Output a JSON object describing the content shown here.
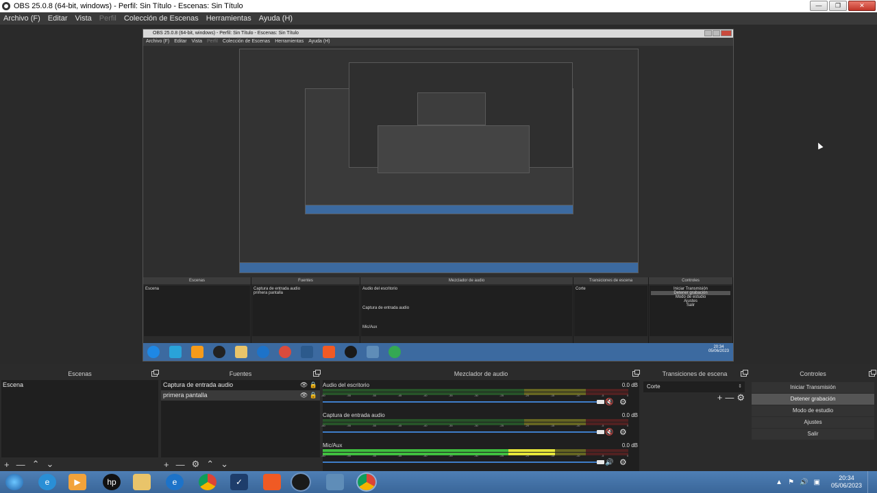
{
  "window": {
    "title": "OBS 25.0.8 (64-bit, windows) - Perfil: Sin Título - Escenas: Sin Título",
    "min": "—",
    "max": "❐",
    "close": "✕"
  },
  "menu": {
    "archivo": "Archivo (F)",
    "editar": "Editar",
    "vista": "Vista",
    "perfil": "Perfil",
    "coleccion": "Colección de Escenas",
    "herramientas": "Herramientas",
    "ayuda": "Ayuda (H)"
  },
  "nested": {
    "title": "OBS 25.0.8 (64-bit, windows) - Perfil: Sin Título - Escenas: Sin Título",
    "menu": [
      "Archivo (F)",
      "Editar",
      "Vista",
      "Perfil",
      "Colección de Escenas",
      "Herramientas",
      "Ayuda (H)"
    ],
    "panels": [
      "Escenas",
      "Fuentes",
      "Mezclador de audio",
      "Transiciones de escena",
      "Controles"
    ],
    "scene": "Escena",
    "sources": [
      "Captura de entrada audio",
      "primera pantalla"
    ],
    "tracks": [
      "Audio del escritorio",
      "Captura de entrada audio",
      "Mic/Aux"
    ],
    "db": "0.0 dB",
    "transition": "Corte",
    "controls": [
      "Iniciar Transmisión",
      "Detener grabación",
      "Modo de estudio",
      "Ajustes",
      "Salir"
    ],
    "time": "20:34",
    "date": "05/06/2023"
  },
  "scenes": {
    "header": "Escenas",
    "items": [
      "Escena"
    ]
  },
  "sources": {
    "header": "Fuentes",
    "items": [
      "Captura de entrada audio",
      "primera pantalla"
    ]
  },
  "mixer": {
    "header": "Mezclador de audio",
    "tracks": [
      {
        "name": "Audio del escritorio",
        "db": "0.0 dB",
        "level": 0.0,
        "fader": 1.0
      },
      {
        "name": "Captura de entrada audio",
        "db": "0.0 dB",
        "level": 0.0,
        "fader": 1.0
      },
      {
        "name": "Mic/Aux",
        "db": "0.0 dB",
        "level": 0.76,
        "fader": 1.0
      }
    ],
    "scale": [
      "-60",
      "-55",
      "-50",
      "-45",
      "-40",
      "-35",
      "-30",
      "-25",
      "-20",
      "-15",
      "-10",
      "-5",
      "0"
    ]
  },
  "transitions": {
    "header": "Transiciones de escena",
    "selected": "Corte"
  },
  "controls": {
    "header": "Controles",
    "start_stream": "Iniciar Transmisión",
    "stop_record": "Detener grabación",
    "studio_mode": "Modo de estudio",
    "settings": "Ajustes",
    "exit": "Salir"
  },
  "footer_glyphs": {
    "add": "+",
    "remove": "—",
    "up": "⌃",
    "down": "⌄",
    "gear": "⚙",
    "eye": "👁",
    "lock": "🔒",
    "speaker": "🔊",
    "muted": "🔇",
    "cursor": "▲"
  },
  "taskbar": {
    "time": "20:34",
    "date": "05/06/2023",
    "tray_up": "▲",
    "tray_flag": "⚑",
    "tray_volume": "🔊",
    "tray_network": "▣",
    "icons": [
      "start-orb-icon",
      "internet-explorer-icon",
      "media-player-icon",
      "hp-icon",
      "file-explorer-icon",
      "edge-icon",
      "chrome-icon",
      "email-icon",
      "brave-icon",
      "obs-icon",
      "photos-icon",
      "chrome-active-icon"
    ]
  },
  "colors": {
    "meter_green": "#2e7d32",
    "meter_yellow": "#9e9e24",
    "meter_red": "#7a2222",
    "fader_blue": "#3f7fcc",
    "taskbar": "#3a6699"
  }
}
